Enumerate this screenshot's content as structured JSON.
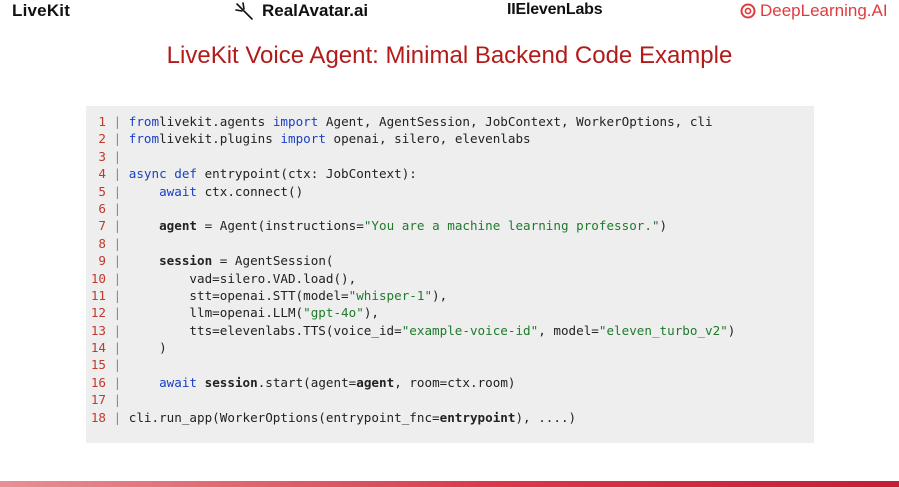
{
  "logos": {
    "livekit": "LiveKit",
    "realavatar": "RealAvatar.ai",
    "elevenlabs": "IIElevenLabs",
    "deeplearning": "DeepLearning.AI"
  },
  "title": "LiveKit Voice Agent: Minimal Backend Code Example",
  "colors": {
    "title": "#b31b1b",
    "keyword": "#1a3fc7",
    "string": "#1f7a2c",
    "line_number": "#c0392b",
    "code_bg": "#eeeeee",
    "brand_red": "#e03a3e"
  },
  "code_lines": [
    {
      "n": "1",
      "segs": [
        [
          "kw",
          "from"
        ],
        [
          "",
          "livekit.agents "
        ],
        [
          "kw",
          "import"
        ],
        [
          "",
          " Agent, AgentSession, JobContext, WorkerOptions, cli"
        ]
      ]
    },
    {
      "n": "2",
      "segs": [
        [
          "kw",
          "from"
        ],
        [
          "",
          "livekit.plugins "
        ],
        [
          "kw",
          "import"
        ],
        [
          "",
          " openai, silero, elevenlabs"
        ]
      ]
    },
    {
      "n": "3",
      "segs": []
    },
    {
      "n": "4",
      "segs": [
        [
          "kw",
          "async def"
        ],
        [
          "",
          " entrypoint(ctx: JobContext):"
        ]
      ]
    },
    {
      "n": "5",
      "segs": [
        [
          "",
          "    "
        ],
        [
          "kw",
          "await"
        ],
        [
          "",
          " ctx.connect()"
        ]
      ]
    },
    {
      "n": "6",
      "segs": []
    },
    {
      "n": "7",
      "segs": [
        [
          "",
          "    "
        ],
        [
          "bold",
          "agent"
        ],
        [
          "",
          " = Agent(instructions="
        ],
        [
          "str",
          "\"You are a machine learning professor.\""
        ],
        [
          "",
          ")"
        ]
      ]
    },
    {
      "n": "8",
      "segs": []
    },
    {
      "n": "9",
      "segs": [
        [
          "",
          "    "
        ],
        [
          "bold",
          "session"
        ],
        [
          "",
          " = AgentSession("
        ]
      ]
    },
    {
      "n": "10",
      "segs": [
        [
          "",
          "        vad=silero.VAD.load(),"
        ]
      ]
    },
    {
      "n": "11",
      "segs": [
        [
          "",
          "        stt=openai.STT(model="
        ],
        [
          "str",
          "\"whisper-1\""
        ],
        [
          "",
          "),"
        ]
      ]
    },
    {
      "n": "12",
      "segs": [
        [
          "",
          "        llm=openai.LLM("
        ],
        [
          "str",
          "\"gpt-4o\""
        ],
        [
          "",
          "),"
        ]
      ]
    },
    {
      "n": "13",
      "segs": [
        [
          "",
          "        tts=elevenlabs.TTS(voice_id="
        ],
        [
          "str",
          "\"example-voice-id\""
        ],
        [
          "",
          ", model="
        ],
        [
          "str",
          "\"eleven_turbo_v2\""
        ],
        [
          "",
          ")"
        ]
      ]
    },
    {
      "n": "14",
      "segs": [
        [
          "",
          "    )"
        ]
      ]
    },
    {
      "n": "15",
      "segs": []
    },
    {
      "n": "16",
      "segs": [
        [
          "",
          "    "
        ],
        [
          "kw",
          "await"
        ],
        [
          "",
          " "
        ],
        [
          "bold",
          "session"
        ],
        [
          "",
          ".start(agent="
        ],
        [
          "bold",
          "agent"
        ],
        [
          "",
          ", room=ctx.room)"
        ]
      ]
    },
    {
      "n": "17",
      "segs": []
    },
    {
      "n": "18",
      "segs": [
        [
          "",
          "cli.run_app(WorkerOptions(entrypoint_fnc="
        ],
        [
          "bold",
          "entrypoint"
        ],
        [
          "",
          "), ....)"
        ]
      ]
    }
  ]
}
